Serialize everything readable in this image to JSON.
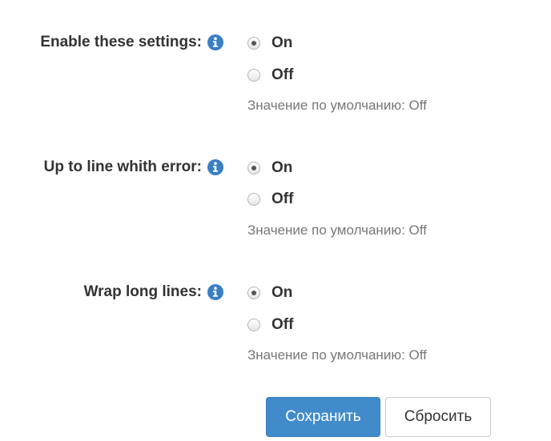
{
  "settings": [
    {
      "label": "Enable these settings:",
      "info_icon": "info-icon",
      "options": [
        {
          "label": "On",
          "checked": true
        },
        {
          "label": "Off",
          "checked": false
        }
      ],
      "default_text": "Значение по умолчанию: Off"
    },
    {
      "label": "Up to line whith error:",
      "info_icon": "info-icon",
      "options": [
        {
          "label": "On",
          "checked": true
        },
        {
          "label": "Off",
          "checked": false
        }
      ],
      "default_text": "Значение по умолчанию: Off"
    },
    {
      "label": "Wrap long lines:",
      "info_icon": "info-icon",
      "options": [
        {
          "label": "On",
          "checked": true
        },
        {
          "label": "Off",
          "checked": false
        }
      ],
      "default_text": "Значение по умолчанию: Off"
    }
  ],
  "buttons": {
    "save_label": "Сохранить",
    "reset_label": "Сбросить"
  },
  "colors": {
    "primary": "#428bca",
    "info_icon": "#3a7fc4",
    "muted_text": "#777777",
    "label_text": "#333333"
  }
}
